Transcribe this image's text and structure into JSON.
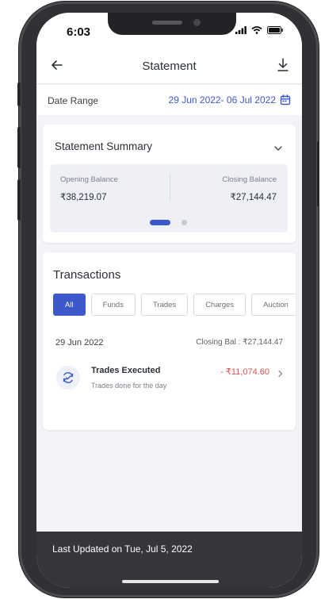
{
  "status_bar": {
    "time": "6:03"
  },
  "header": {
    "title": "Statement"
  },
  "date_range": {
    "label": "Date Range",
    "value": "29 Jun 2022- 06 Jul 2022"
  },
  "summary": {
    "title": "Statement Summary",
    "opening_label": "Opening Balance",
    "opening_value": "₹38,219.07",
    "closing_label": "Closing Balance",
    "closing_value": "₹27,144.47",
    "pages": 2,
    "active_page": 1
  },
  "transactions": {
    "title": "Transactions",
    "tabs": [
      {
        "label": "All",
        "active": true
      },
      {
        "label": "Funds",
        "active": false
      },
      {
        "label": "Trades",
        "active": false
      },
      {
        "label": "Charges",
        "active": false
      },
      {
        "label": "Auction",
        "active": false
      }
    ],
    "groups": [
      {
        "date": "29 Jun 2022",
        "closing": "Closing Bal : ₹27,144.47",
        "items": [
          {
            "name": "Trades Executed",
            "subtitle": "Trades done for the day",
            "amount": "- ₹11,074.60",
            "icon": "sync-check-icon"
          }
        ]
      }
    ]
  },
  "footer": {
    "text": "Last Updated on Tue, Jul 5, 2022"
  },
  "colors": {
    "accent": "#3d58c9",
    "negative": "#d9534f",
    "footer": "#34363a"
  }
}
